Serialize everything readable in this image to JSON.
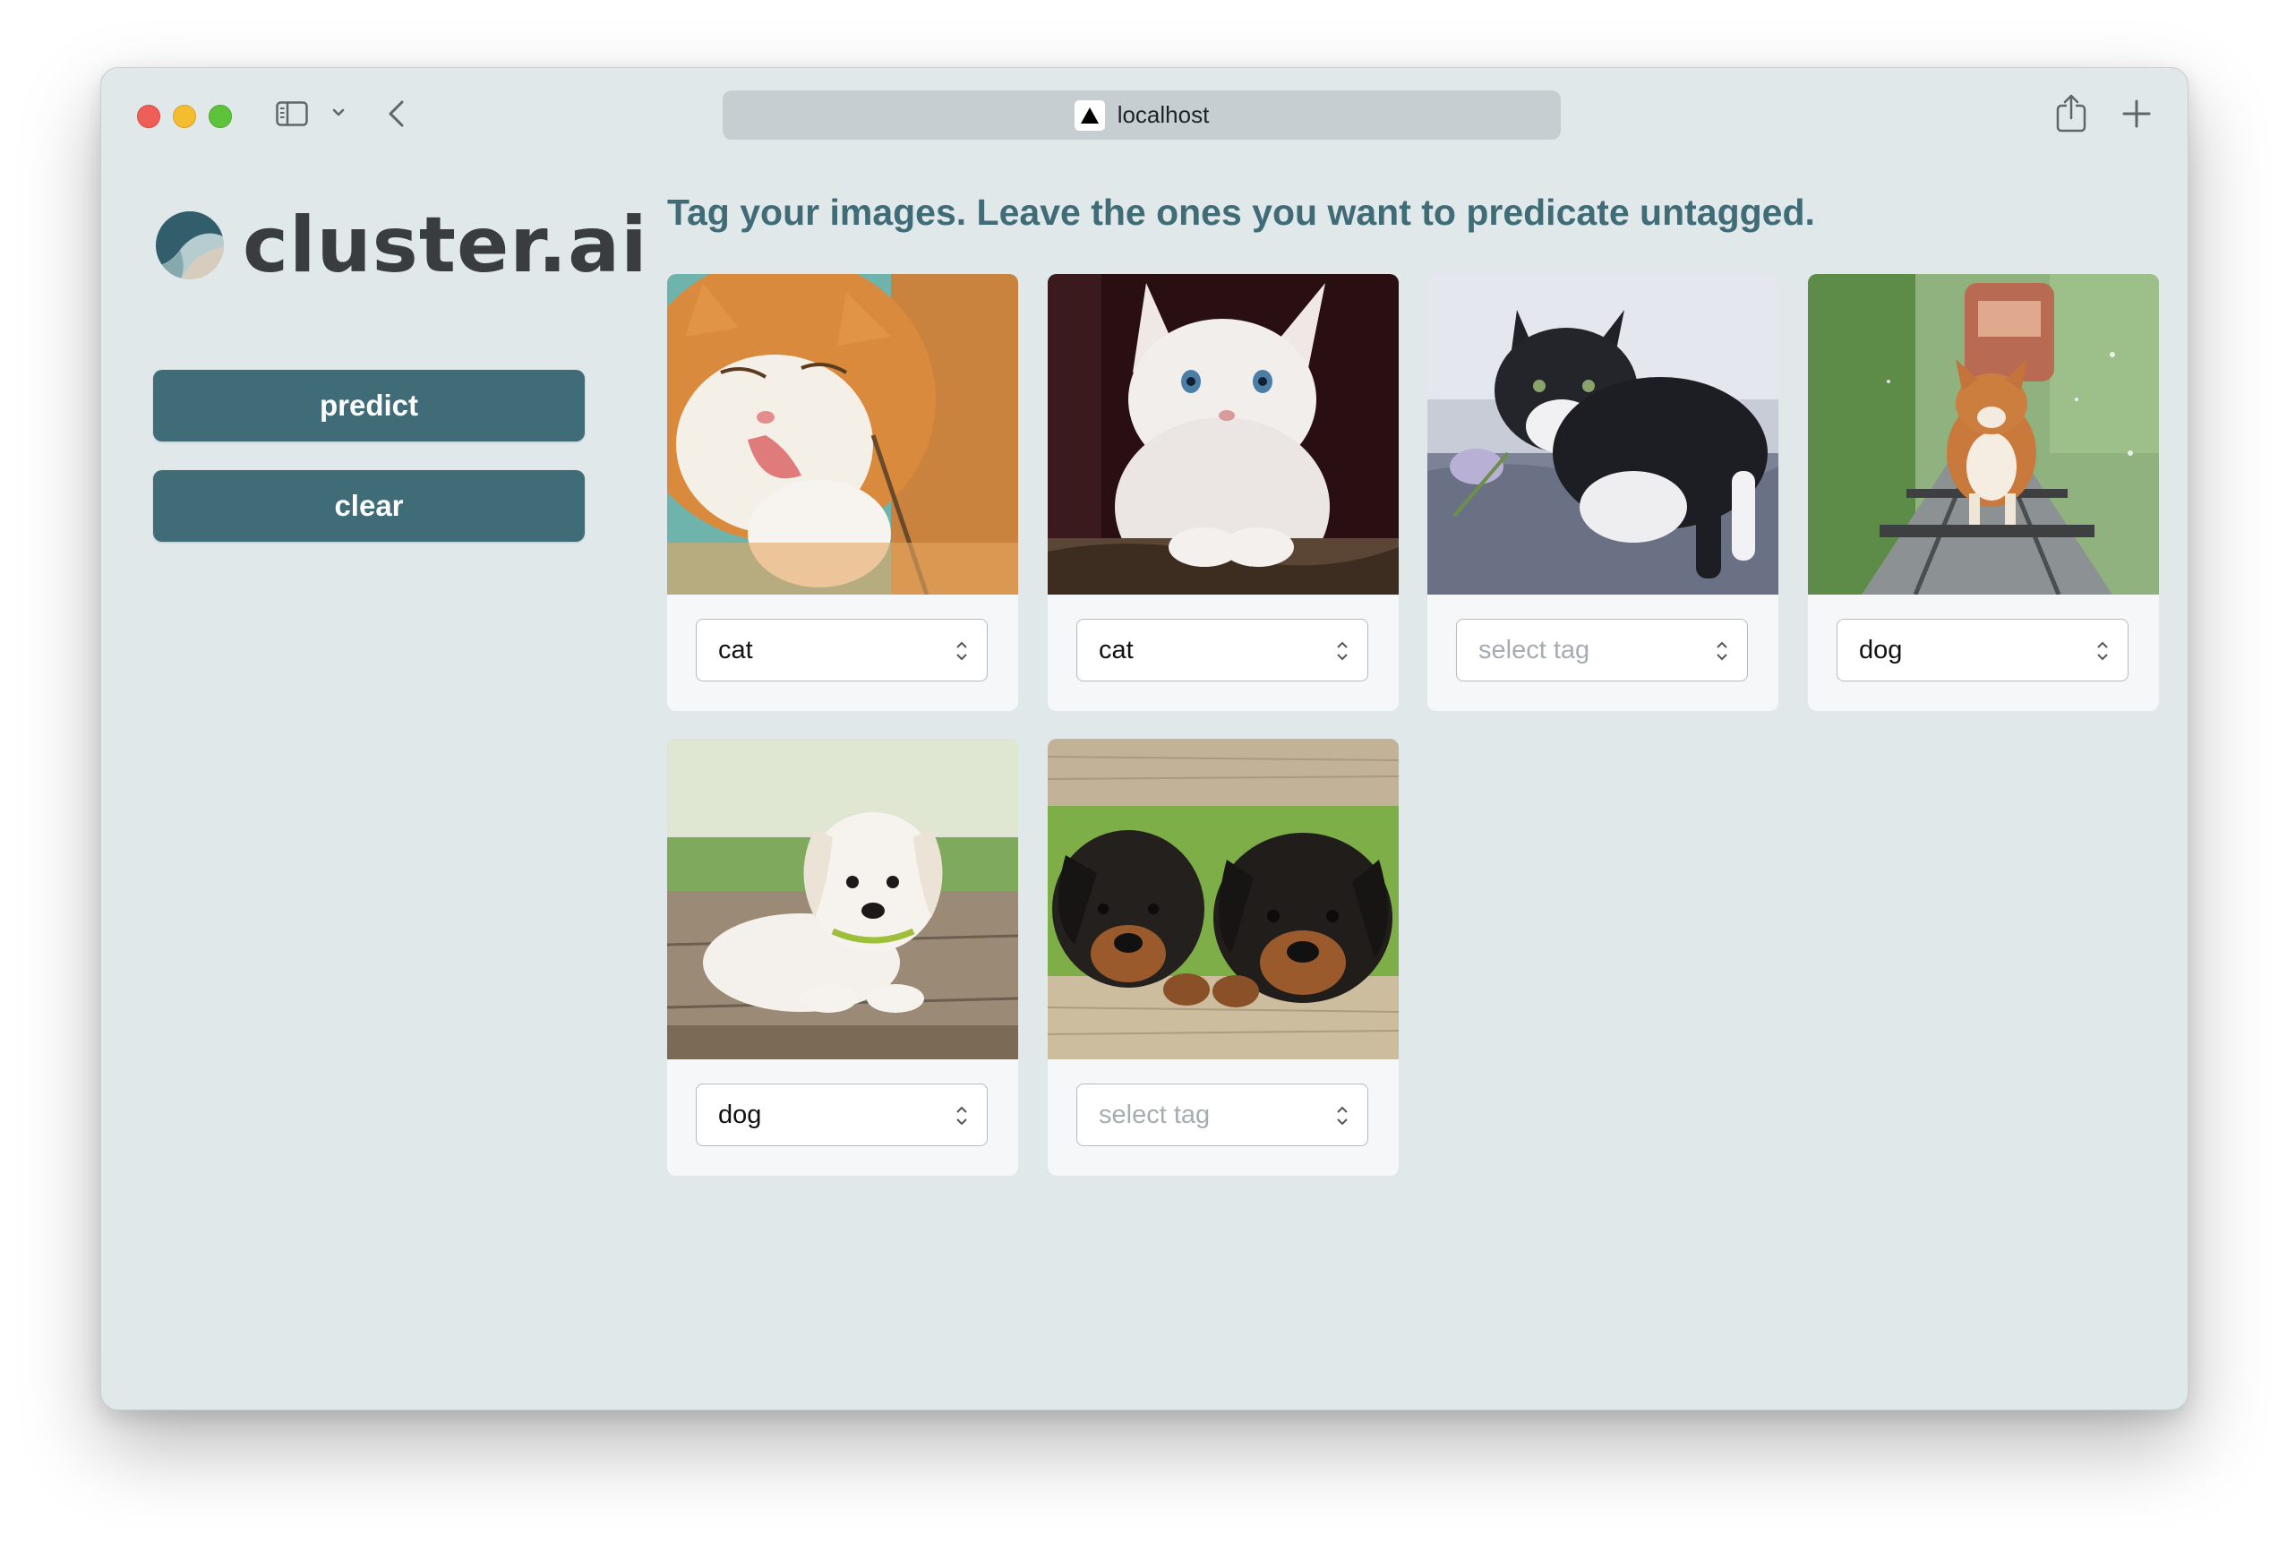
{
  "browser": {
    "address": "localhost"
  },
  "app": {
    "logo_text": "cluster.ai",
    "buttons": {
      "predict": "predict",
      "clear": "clear"
    },
    "heading": "Tag your images. Leave the ones you want to predicate untagged."
  },
  "images": [
    {
      "subject": "orange and white cat licking paw",
      "tag": "cat",
      "placeholder": false
    },
    {
      "subject": "white kitten",
      "tag": "cat",
      "placeholder": false
    },
    {
      "subject": "black and white kitten with flower",
      "tag": "select tag",
      "placeholder": true
    },
    {
      "subject": "corgi running on rail tracks",
      "tag": "dog",
      "placeholder": false
    },
    {
      "subject": "white puppy lying on wood",
      "tag": "dog",
      "placeholder": false
    },
    {
      "subject": "two rottweiler puppies",
      "tag": "select tag",
      "placeholder": true
    }
  ],
  "colors": {
    "accent": "#3f6c77",
    "background": "#e1e8ea",
    "card": "#f5f7f8"
  }
}
